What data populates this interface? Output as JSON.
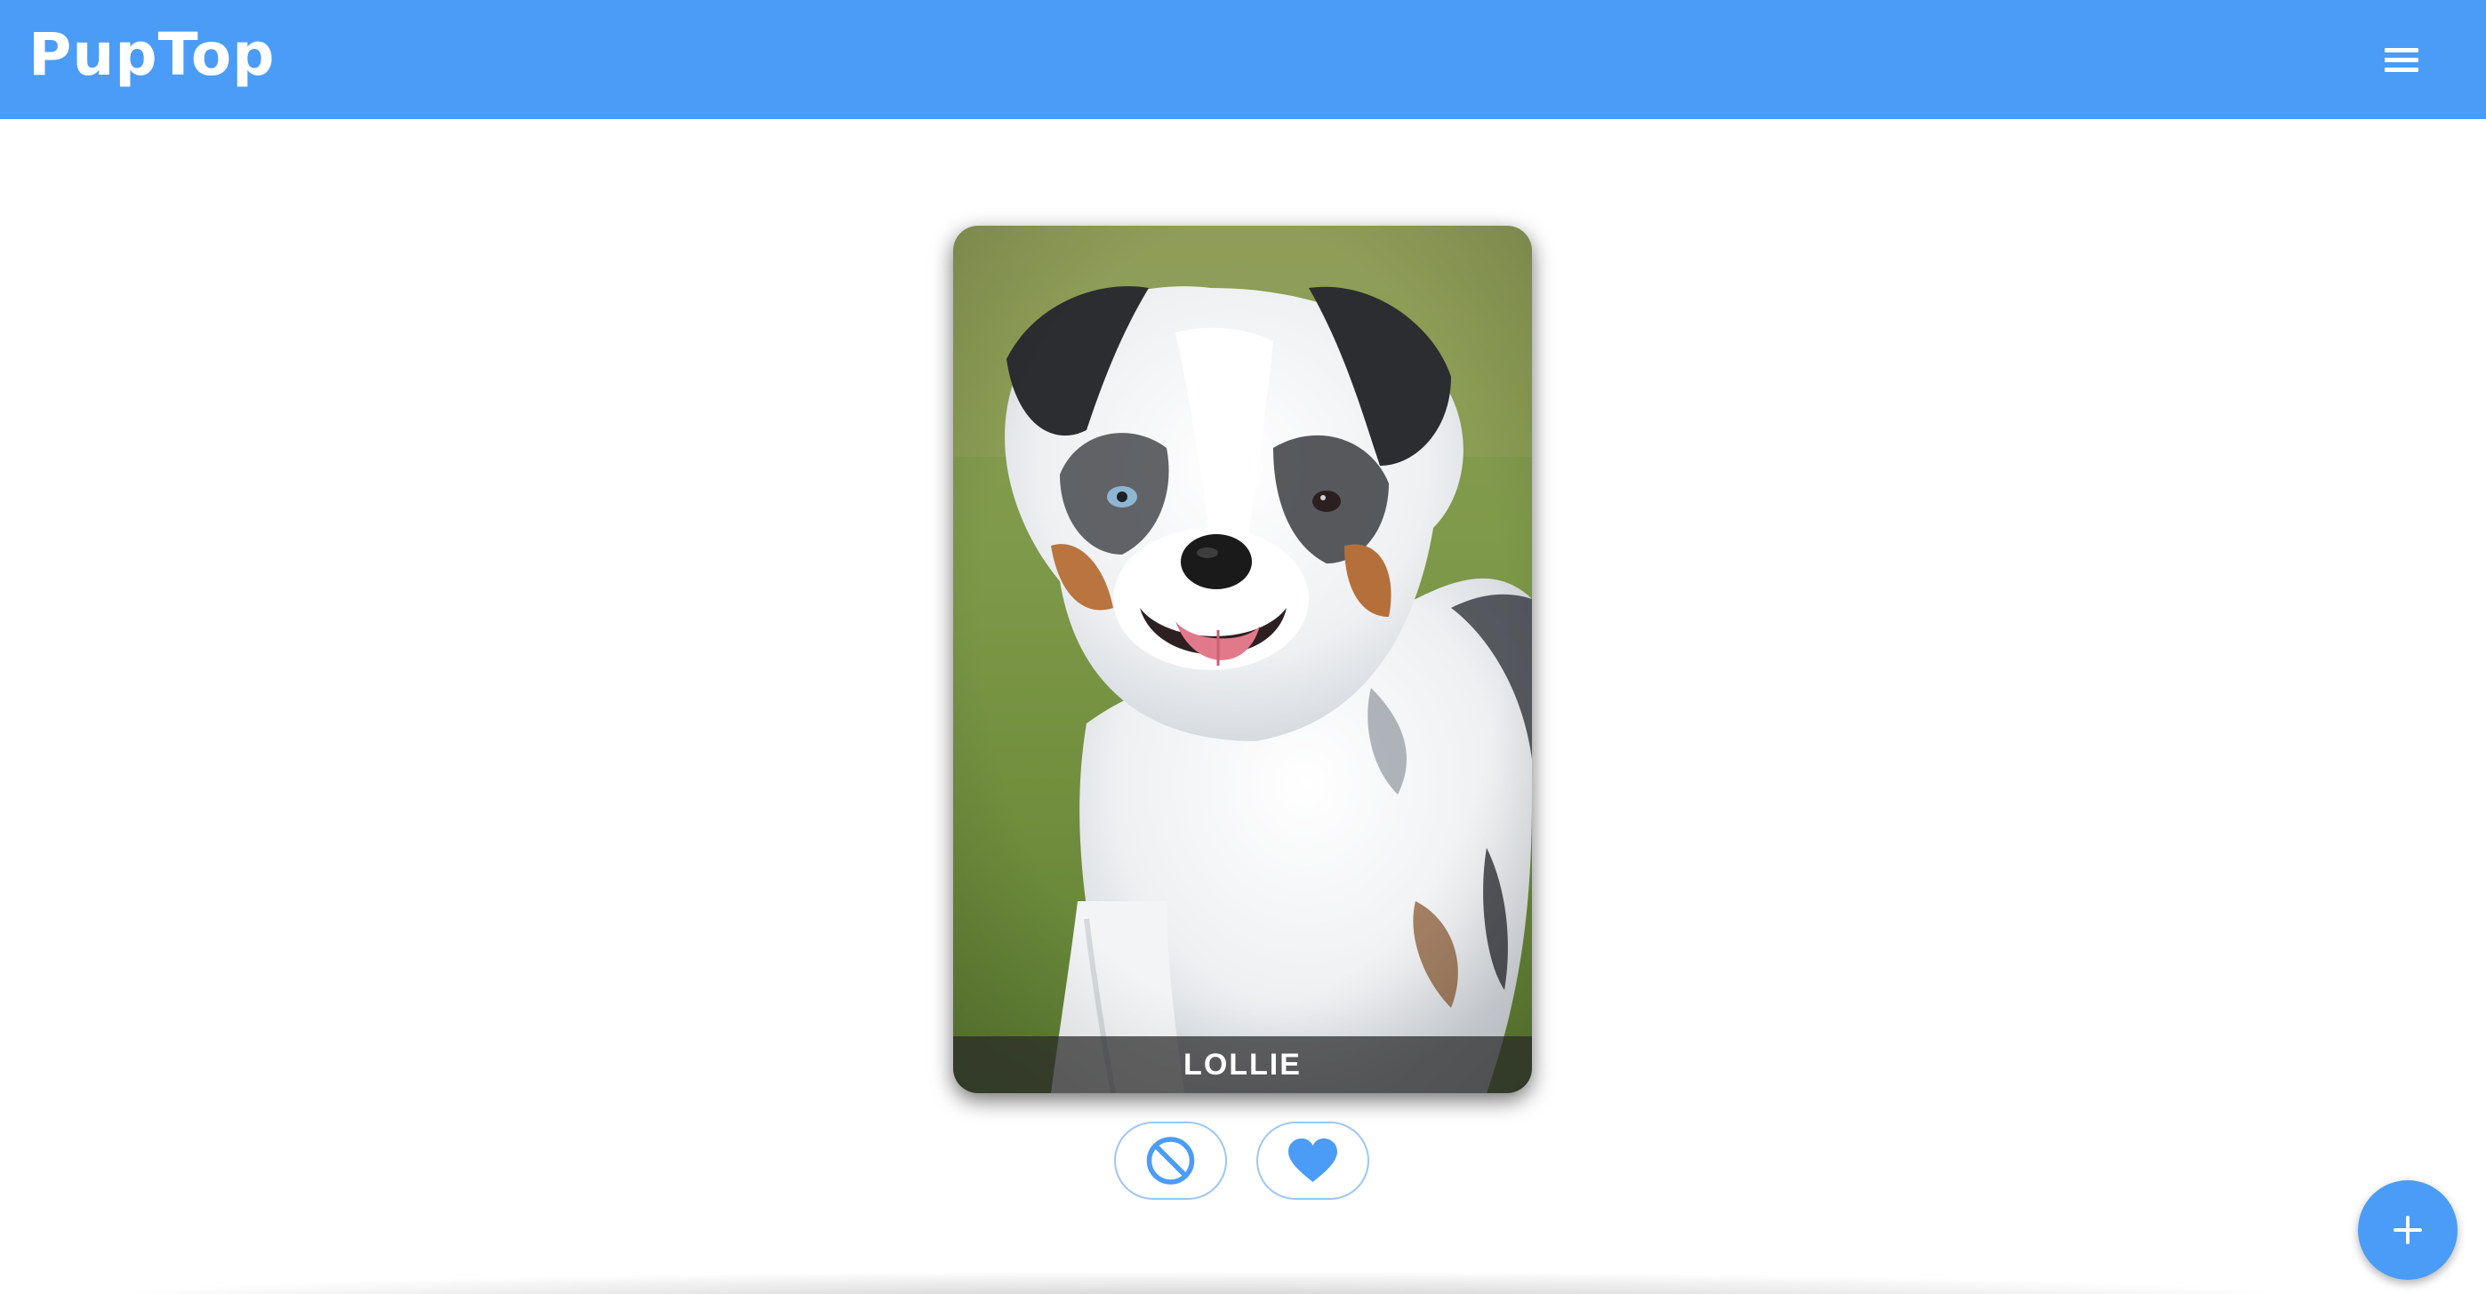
{
  "app": {
    "brand": "PupTop"
  },
  "header": {
    "menu_icon": "hamburger-menu-icon"
  },
  "card": {
    "dog_name": "LOLLIE",
    "photo_description_icon": "dog-photo"
  },
  "actions": {
    "pass_icon": "block-icon",
    "like_icon": "heart-icon"
  },
  "fab": {
    "icon": "plus-icon"
  },
  "colors": {
    "brand_blue": "#4a9cf7",
    "button_border": "#9cc6f6",
    "background": "#ffffff"
  }
}
